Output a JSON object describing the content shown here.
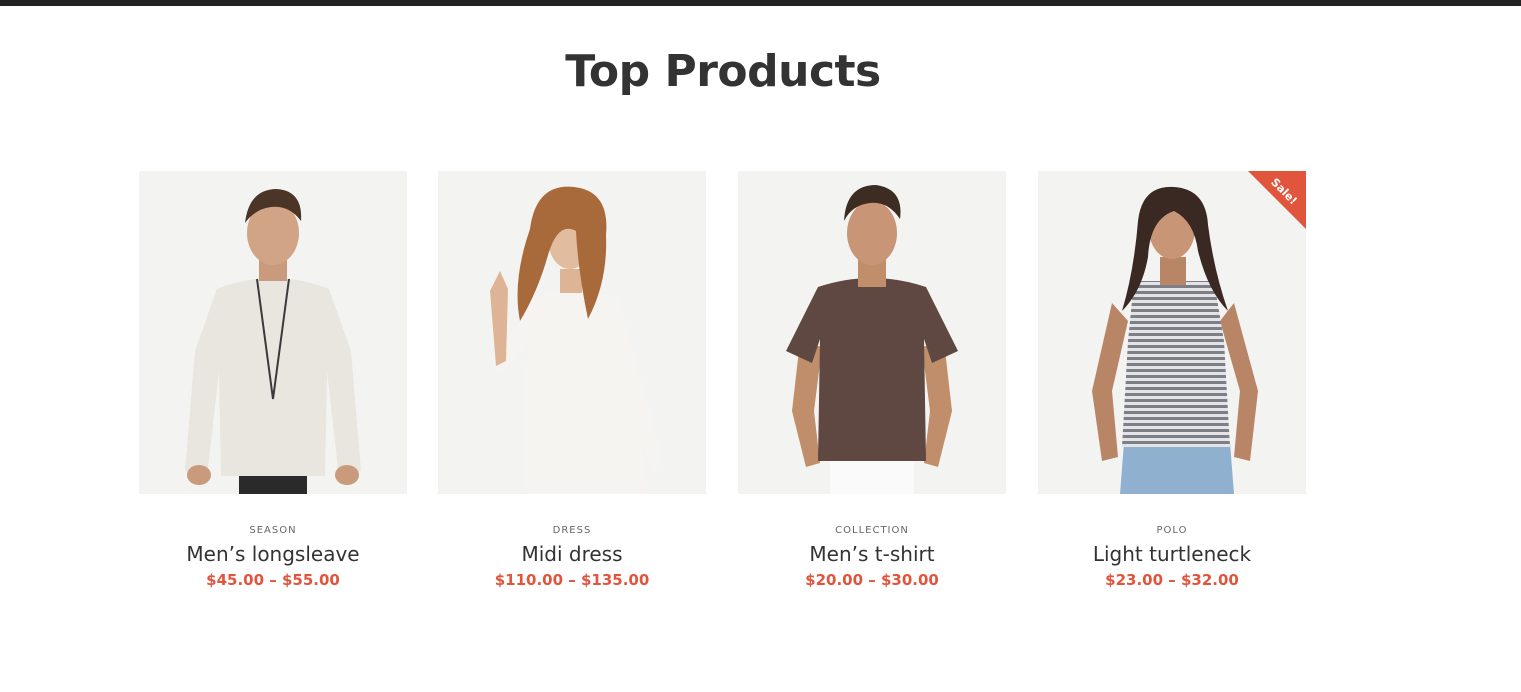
{
  "section": {
    "title": "Top Products"
  },
  "colors": {
    "accent": "#e2553d",
    "text": "#333333",
    "image_bg": "#f3f3f2"
  },
  "products": [
    {
      "category": "SEASON",
      "name": "Men’s longsleave",
      "price": "$45.00 – $55.00",
      "image": "man-white-longsleeve-photo",
      "sale": false
    },
    {
      "category": "DRESS",
      "name": "Midi dress",
      "price": "$110.00 – $135.00",
      "image": "woman-white-dress-photo",
      "sale": false
    },
    {
      "category": "COLLECTION",
      "name": "Men’s t-shirt",
      "price": "$20.00 – $30.00",
      "image": "man-brown-tshirt-photo",
      "sale": false
    },
    {
      "category": "POLO",
      "name": "Light turtleneck",
      "price": "$23.00 – $32.00",
      "image": "woman-striped-top-photo",
      "sale": true,
      "sale_label": "Sale!"
    }
  ]
}
